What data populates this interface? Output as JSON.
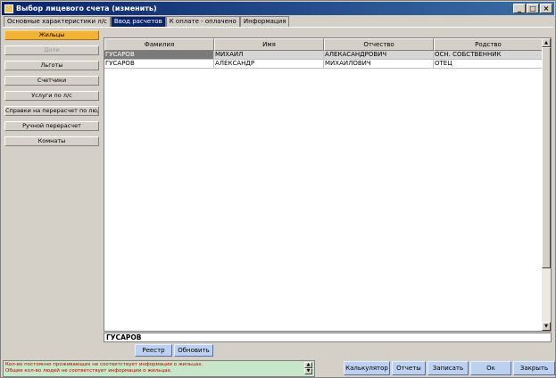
{
  "window": {
    "title": "Выбор лицевого счета (изменить)",
    "min": "_",
    "max": "□",
    "close": "×"
  },
  "tabs": [
    {
      "label": "Основные характеристики л/с",
      "active": false
    },
    {
      "label": "Ввод расчетов",
      "active": true
    },
    {
      "label": "К оплате - оплачено",
      "active": false
    },
    {
      "label": "Информация",
      "active": false
    }
  ],
  "menu": [
    {
      "label": "Жильцы",
      "state": "active"
    },
    {
      "label": "Доли",
      "state": "disabled"
    },
    {
      "label": "Льготы",
      "state": "normal"
    },
    {
      "label": "Счетчики",
      "state": "normal"
    },
    {
      "label": "Услуги по л/с",
      "state": "normal"
    },
    {
      "label": "Справки на перерасчет по людям",
      "state": "normal"
    },
    {
      "label": "Ручной перерасчет",
      "state": "normal"
    },
    {
      "label": "Комнаты",
      "state": "normal"
    }
  ],
  "table": {
    "columns": [
      "Фамилия",
      "Имя",
      "Отчество",
      "Родство"
    ],
    "rows": [
      [
        "ГУСАРОВ",
        "МИХАИЛ",
        "АЛЕКАСАНДРОВИЧ",
        "ОСН. СОБСТВЕННИК"
      ],
      [
        "ГУСАРОВ",
        "АЛЕКСАНДР",
        "МИХАЙЛОВИЧ",
        "ОТЕЦ"
      ]
    ],
    "selected_row": 0
  },
  "name_field": {
    "value": "ГУСАРОВ"
  },
  "sub_buttons": {
    "registry": "Реестр",
    "refresh": "Обновить"
  },
  "status": {
    "line1": "Кол-во постоянно проживающих не соответствует информации о жильцах.",
    "line2": "Общее кол-во людей не соответствует информации о жильцах."
  },
  "bottom_buttons": {
    "calculator": "Калькулятор",
    "reports": "Отчеты",
    "save": "Записать",
    "ok": "Ок",
    "close": "Закрыть"
  },
  "colors": {
    "active_menu": "#f2b233",
    "active_tab": "#0a246a",
    "status_bg": "#c8e6c8",
    "status_text": "#c00000"
  }
}
